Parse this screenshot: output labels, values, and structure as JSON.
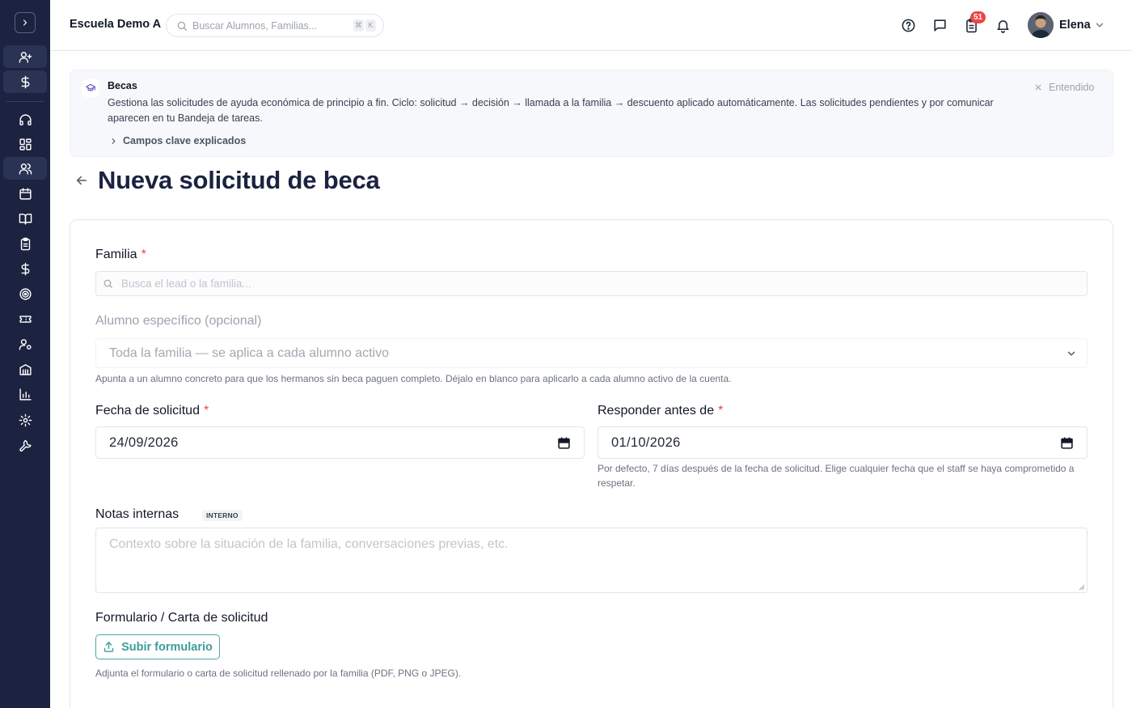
{
  "header": {
    "school_name": "Escuela Demo A",
    "search_placeholder": "Buscar Alumnos, Familias...",
    "shortcut_keys": [
      "⌘",
      "K"
    ],
    "tasks_badge": "51",
    "user_name": "Elena"
  },
  "banner": {
    "title": "Becas",
    "text": "Gestiona las solicitudes de ayuda económica de principio a fin. Ciclo: solicitud → decisión → llamada a la familia → descuento aplicado automáticamente. Las solicitudes pendientes y por comunicar aparecen en tu Bandeja de tareas.",
    "expand_link": "Campos clave explicados",
    "dismiss": "Entendido"
  },
  "page": {
    "title": "Nueva solicitud de beca"
  },
  "form": {
    "family_label": "Familia",
    "family_placeholder": "Busca el lead o la familia...",
    "required_mark": "*",
    "student_label": "Alumno específico (opcional)",
    "student_value": "Toda la familia — se aplica a cada alumno activo",
    "student_help": "Apunta a un alumno concreto para que los hermanos sin beca paguen completo. Déjalo en blanco para aplicarlo a cada alumno activo de la cuenta.",
    "request_date_label": "Fecha de solicitud",
    "request_date_value": "24/09/2026",
    "respond_by_label": "Responder antes de",
    "respond_by_value": "01/10/2026",
    "respond_by_help": "Por defecto, 7 días después de la fecha de solicitud. Elige cualquier fecha que el staff se haya comprometido a respetar.",
    "notes_label": "Notas internas",
    "notes_tag": "INTERNO",
    "notes_placeholder": "Contexto sobre la situación de la familia, conversaciones previas, etc.",
    "upload_label": "Formulario / Carta de solicitud",
    "upload_button": "Subir formulario",
    "upload_help": "Adjunta el formulario o carta de solicitud rellenado por la familia (PDF, PNG o JPEG)."
  },
  "colors": {
    "sidebar_bg": "#1c2340",
    "accent_teal": "#3d9d9b",
    "required_red": "#ef4444",
    "badge_red": "#ef4444"
  }
}
